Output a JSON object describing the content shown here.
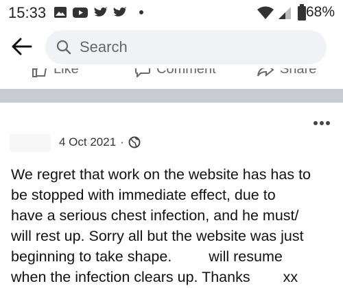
{
  "status_bar": {
    "time": "15:33",
    "battery": "68%",
    "icons": [
      "gallery-icon",
      "youtube-icon",
      "twitter-icon",
      "twitter-icon",
      "dot-icon",
      "wifi-icon",
      "signal-icon",
      "battery-icon"
    ]
  },
  "header": {
    "search_placeholder": "Search"
  },
  "actions": {
    "like": "Like",
    "comment": "Comment",
    "share": "Share"
  },
  "post": {
    "date": "4 Oct 2021",
    "dot": "·",
    "privacy_icon": "globe-icon",
    "lines": [
      "We regret that work on the website has has to",
      "be stopped with immediate effect, due to",
      "have a serious chest infection, and he must/",
      "will rest up. Sorry all but the website was just",
      "beginning to take shape.",
      "will resume",
      "when the infection clears up. Thanks",
      "xx"
    ]
  },
  "colors": {
    "separator": "#c9ccd1",
    "search_bg": "#f0f2f5",
    "muted_text": "#65676b"
  }
}
